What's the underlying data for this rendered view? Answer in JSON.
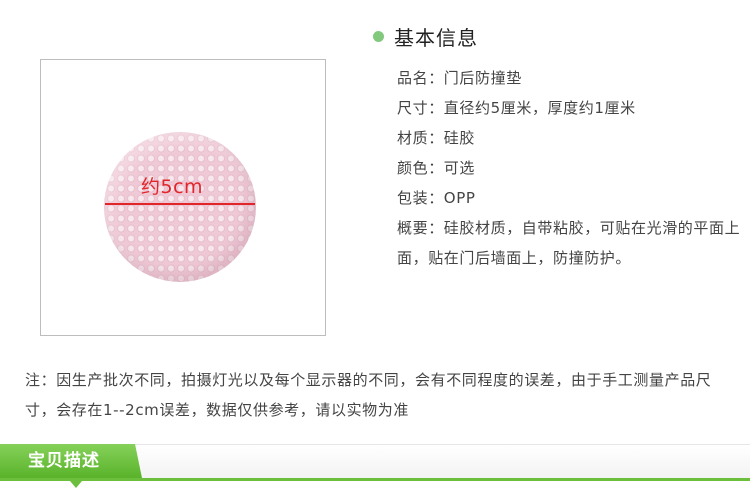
{
  "image": {
    "size_label": "约5cm"
  },
  "info": {
    "title": "基本信息",
    "rows": [
      "品名：门后防撞垫",
      "尺寸：直径约5厘米，厚度约1厘米",
      "材质：硅胶",
      "颜色：可选",
      "包装：OPP",
      "概要：硅胶材质，自带粘胶，可贴在光滑的平面上面，贴在门后墙面上，防撞防护。"
    ]
  },
  "note": "注：因生产批次不同，拍摄灯光以及每个显示器的不同，会有不同程度的误差，由于手工测量产品尺寸，会存在1--2cm误差，数据仅供参考，请以实物为准",
  "section": {
    "tab_label": "宝贝描述"
  },
  "colors": {
    "accent_green": "#6cbf3d",
    "dot_green": "#82c97e",
    "measure_red": "#e0262a",
    "pad_pink": "#f0c9d6"
  }
}
